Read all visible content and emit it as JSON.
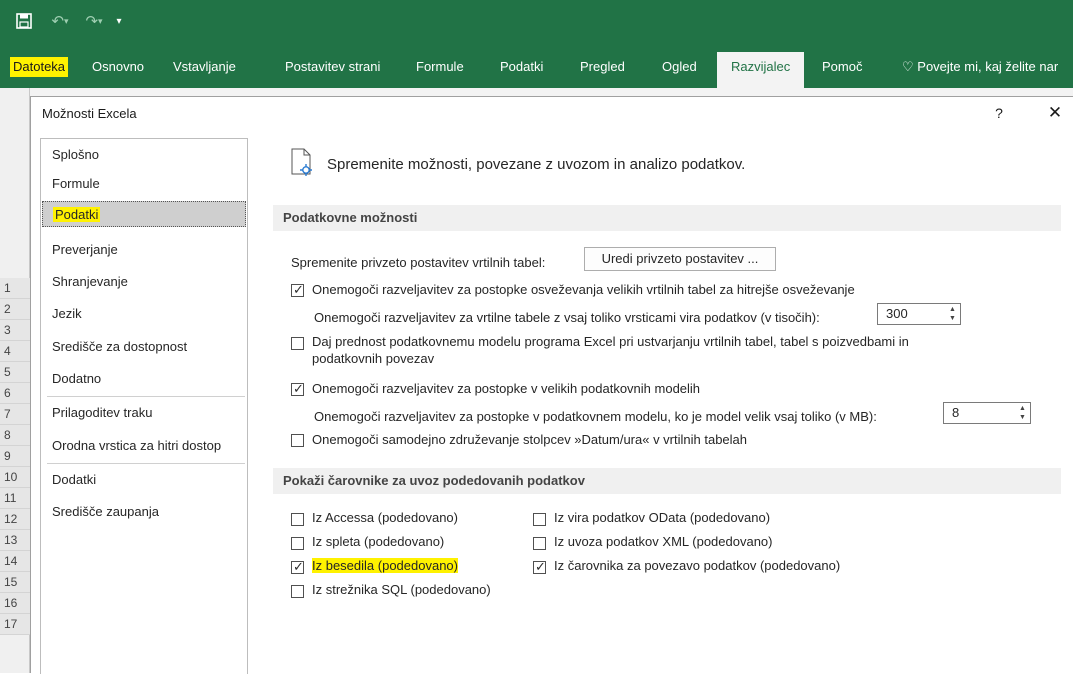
{
  "excel": {
    "tabs": [
      "Datoteka",
      "Osnovno",
      "Vstavljanje",
      "Postavitev strani",
      "Formule",
      "Podatki",
      "Pregled",
      "Ogled",
      "Razvijalec",
      "Pomoč"
    ],
    "tell_me": "Povejte mi, kaj želite nar",
    "row_numbers": [
      "1",
      "2",
      "3",
      "4",
      "5",
      "6",
      "7",
      "8",
      "9",
      "10",
      "11",
      "12",
      "13",
      "14",
      "15",
      "16",
      "17"
    ]
  },
  "dialog": {
    "title": "Možnosti Excela",
    "help": "?",
    "close": "✕",
    "nav": [
      "Splošno",
      "Formule",
      "Podatki",
      "Preverjanje",
      "Shranjevanje",
      "Jezik",
      "Središče za dostopnost",
      "Dodatno",
      "Prilagoditev traku",
      "Orodna vrstica za hitri dostop",
      "Dodatki",
      "Središče zaupanja"
    ],
    "selected_nav": "Podatki",
    "header": "Spremenite možnosti, povezane z uvozom in analizo podatkov.",
    "section1": "Podatkovne možnosti",
    "pivot_label": "Spremenite privzeto postavitev vrtilnih tabel:",
    "pivot_button": "Uredi privzeto postavitev ...",
    "opt_undo_refresh": "Onemogoči razveljavitev za postopke osveževanja velikih vrtilnih tabel za hitrejše osveževanje",
    "opt_undo_rows_label": "Onemogoči razveljavitev za vrtilne tabele z vsaj toliko vrsticami vira podatkov (v tisočih):",
    "opt_undo_rows_value": "300",
    "opt_data_model_line1": "Daj prednost podatkovnemu modelu programa Excel pri ustvarjanju vrtilnih tabel, tabel s poizvedbami in",
    "opt_data_model_line2": "podatkovnih povezav",
    "opt_undo_large_models": "Onemogoči razveljavitev za postopke v velikih podatkovnih modelih",
    "opt_undo_mb_label": "Onemogoči razveljavitev za postopke v podatkovnem modelu, ko je model velik vsaj toliko (v MB):",
    "opt_undo_mb_value": "8",
    "opt_auto_grouping": "Onemogoči samodejno združevanje stolpcev »Datum/ura« v vrtilnih tabelah",
    "section2": "Pokaži čarovnike za uvoz podedovanih podatkov",
    "legacy": {
      "access": "Iz Accessa (podedovano)",
      "web": "Iz spleta (podedovano)",
      "text": "Iz besedila (podedovano)",
      "sql": "Iz strežnika SQL (podedovano)",
      "odata": "Iz vira podatkov OData (podedovano)",
      "xml": "Iz uvoza podatkov XML (podedovano)",
      "wizard": "Iz čarovnika za povezavo podatkov (podedovano)"
    },
    "checked": {
      "undo_refresh": true,
      "data_model": false,
      "undo_large_models": true,
      "auto_grouping": false,
      "access": false,
      "web": false,
      "text": true,
      "sql": false,
      "odata": false,
      "xml": false,
      "wizard": true
    }
  },
  "colors": {
    "excel_green": "#217346",
    "highlight": "#fff200"
  }
}
